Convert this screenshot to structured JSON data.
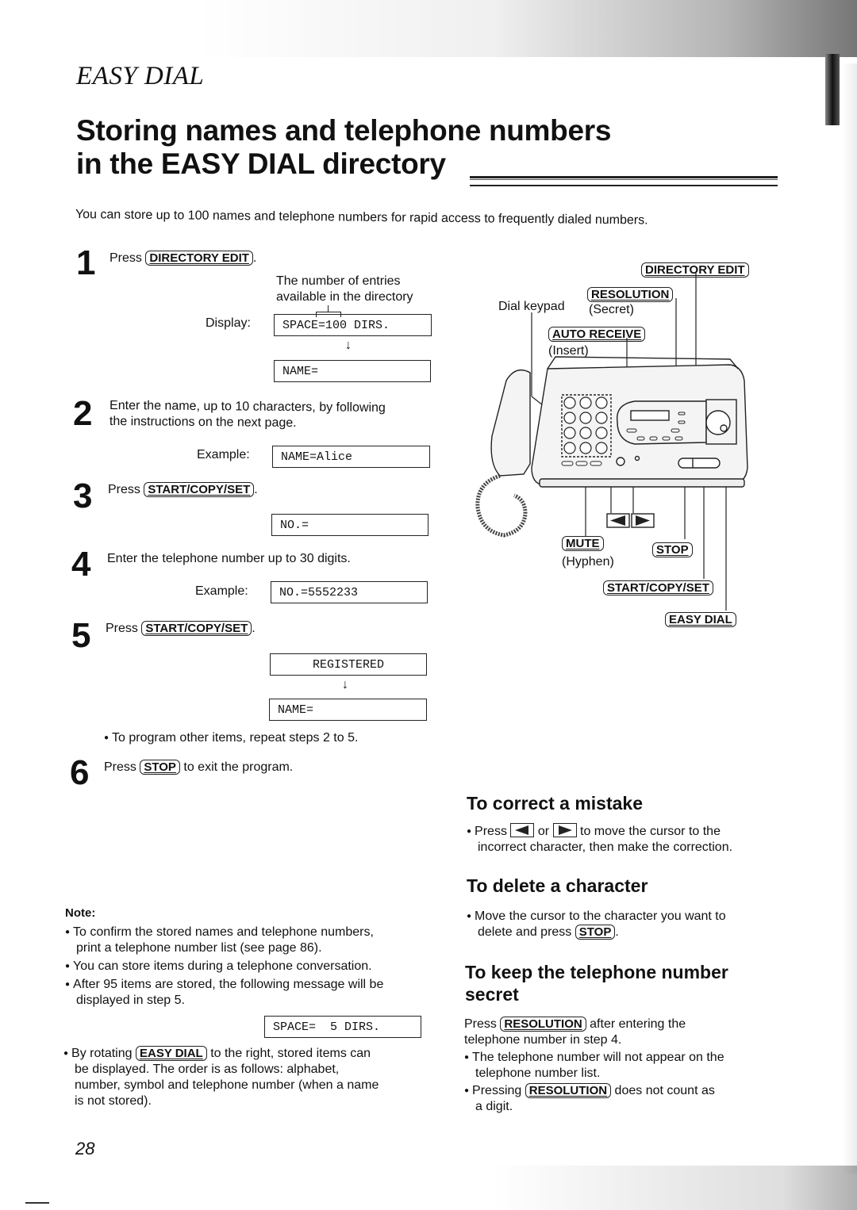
{
  "section_label": "EASY DIAL",
  "title_line1": "Storing names and telephone numbers",
  "title_line2": "in the EASY DIAL directory",
  "intro": "You can store up to 100 names and telephone numbers for rapid access to frequently dialed numbers.",
  "steps": [
    {
      "num": "1",
      "prefix": "Press",
      "key": "DIRECTORY EDIT",
      "suffix": ".",
      "annotation_line1": "The number of entries",
      "annotation_line2": "available in the directory",
      "display_label": "Display:",
      "displays": [
        "SPACE=100 DIRS.",
        "NAME="
      ]
    },
    {
      "num": "2",
      "text_line1": "Enter the name, up to 10 characters, by following",
      "text_line2": "the instructions on the next page.",
      "example_label": "Example:",
      "displays": [
        "NAME=Alice"
      ]
    },
    {
      "num": "3",
      "prefix": "Press",
      "key": "START/COPY/SET",
      "suffix": ".",
      "displays": [
        "NO.="
      ]
    },
    {
      "num": "4",
      "text": "Enter the telephone number up to 30 digits.",
      "example_label": "Example:",
      "displays": [
        "NO.=5552233"
      ]
    },
    {
      "num": "5",
      "prefix": "Press",
      "key": "START/COPY/SET",
      "suffix": ".",
      "displays": [
        "REGISTERED",
        "NAME="
      ],
      "bullet": "To program other items, repeat steps 2 to 5."
    },
    {
      "num": "6",
      "prefix": "Press",
      "key": "STOP",
      "suffix": "to exit the program."
    }
  ],
  "diagram": {
    "labels": {
      "directory_edit": "DIRECTORY EDIT",
      "resolution": "RESOLUTION",
      "resolution_sub": "(Secret)",
      "dial_keypad": "Dial keypad",
      "auto_receive": "AUTO RECEIVE",
      "auto_receive_sub": "(Insert)",
      "mute": "MUTE",
      "mute_sub": "(Hyphen)",
      "stop": "STOP",
      "start_copy_set": "START/COPY/SET",
      "easy_dial": "EASY DIAL"
    }
  },
  "correct_mistake": {
    "heading": "To correct a mistake",
    "text_prefix": "Press",
    "text_or": "or",
    "text_suffix": "to move the cursor to the",
    "text_line2": "incorrect character, then make the correction."
  },
  "delete_character": {
    "heading": "To delete a character",
    "text_line1": "Move the cursor to the character you want to",
    "text_line2_prefix": "delete and press",
    "key": "STOP",
    "text_line2_suffix": "."
  },
  "keep_secret": {
    "heading_line1": "To keep the telephone number",
    "heading_line2": "secret",
    "text_prefix": "Press",
    "key": "RESOLUTION",
    "text_suffix": "after entering the",
    "text_line2": "telephone number in step 4.",
    "bullet1_line1": "The telephone number will not appear on the",
    "bullet1_line2": "telephone number list.",
    "bullet2_prefix": "Pressing",
    "bullet2_key": "RESOLUTION",
    "bullet2_suffix": "does not count as",
    "bullet2_line2": "a digit."
  },
  "note": {
    "heading": "Note:",
    "items": [
      {
        "line1": "To confirm the stored names and telephone numbers,",
        "line2": "print a telephone number list (see page 86)."
      },
      {
        "line1": "You can store items during a telephone conversation."
      },
      {
        "line1": "After 95 items are stored, the following message will be",
        "line2": "displayed in step 5.",
        "display": "SPACE=  5 DIRS."
      },
      {
        "prefix": "By rotating",
        "key": "EASY DIAL",
        "suffix": "to the right, stored items can",
        "line2": "be displayed. The order is as follows: alphabet,",
        "line3": "number, symbol and telephone number (when a name",
        "line4": "is not stored)."
      }
    ]
  },
  "page_number": "28"
}
